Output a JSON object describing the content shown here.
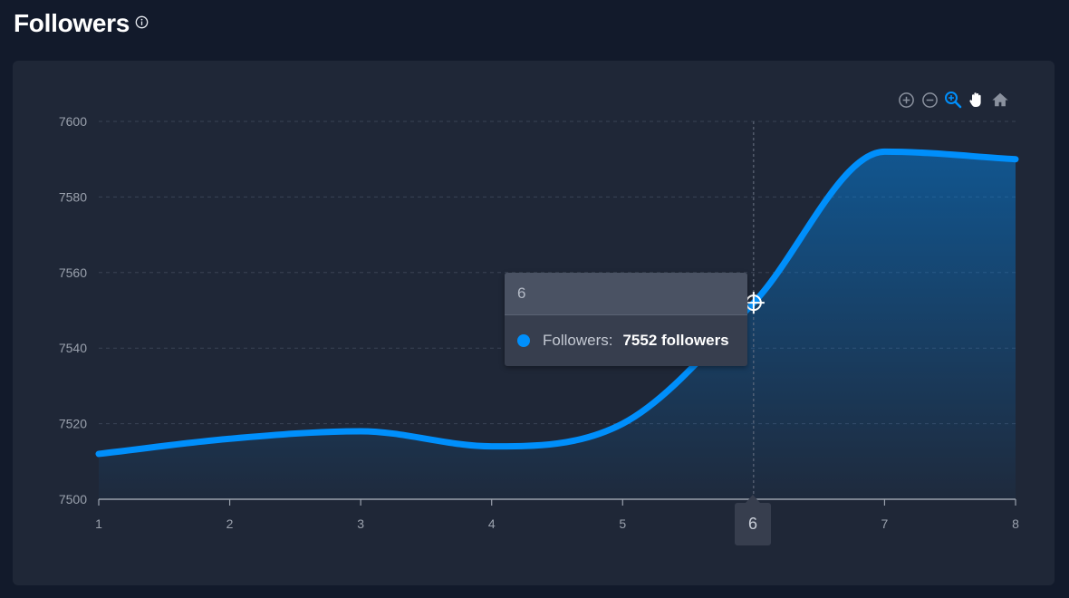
{
  "header": {
    "title": "Followers"
  },
  "toolbar": {
    "buttons": [
      "zoom-in-icon",
      "zoom-out-icon",
      "selection-zoom-icon",
      "pan-icon",
      "reset-home-icon"
    ]
  },
  "tooltip": {
    "x_label": "6",
    "series_name": "Followers:",
    "value_text": "7552 followers"
  },
  "crosshair": {
    "x_label": "6",
    "x_value": 6,
    "y_value": 7552
  },
  "colors": {
    "series": "#008ffb",
    "background": "#121a2b",
    "card": "#1f2737",
    "grid": "#3a4355",
    "axis_text": "#9aa1ad"
  },
  "chart_data": {
    "type": "area",
    "title": "Followers",
    "x": [
      1,
      2,
      3,
      4,
      5,
      6,
      7,
      8
    ],
    "series": [
      {
        "name": "Followers",
        "values": [
          7512,
          7516,
          7518,
          7514,
          7520,
          7552,
          7592,
          7590
        ]
      }
    ],
    "xlabel": "",
    "ylabel": "",
    "ylim": [
      7500,
      7600
    ],
    "xlim": [
      1,
      8
    ],
    "yticks": [
      7500,
      7520,
      7540,
      7560,
      7580,
      7600
    ],
    "xticks": [
      1,
      2,
      3,
      4,
      5,
      6,
      7,
      8
    ],
    "grid": true,
    "legend": "none",
    "curve": "smooth"
  }
}
